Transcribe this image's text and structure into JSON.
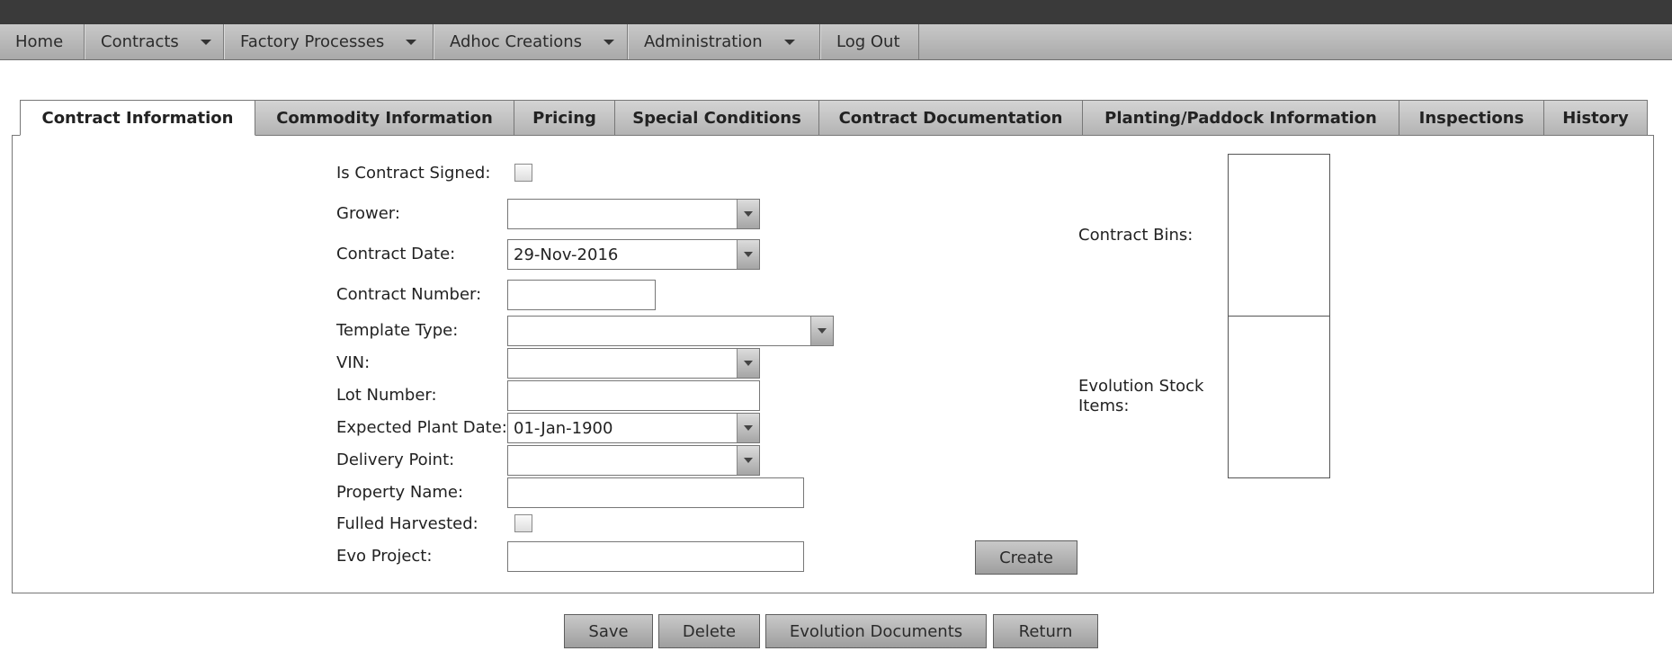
{
  "menu": {
    "items": [
      {
        "label": "Home",
        "has_dropdown": false
      },
      {
        "label": "Contracts",
        "has_dropdown": true
      },
      {
        "label": "Factory Processes",
        "has_dropdown": true
      },
      {
        "label": "Adhoc Creations",
        "has_dropdown": true
      },
      {
        "label": "Administration",
        "has_dropdown": true
      },
      {
        "label": "Log Out",
        "has_dropdown": false
      }
    ]
  },
  "tabs": [
    {
      "label": "Contract Information",
      "active": true
    },
    {
      "label": "Commodity Information",
      "active": false
    },
    {
      "label": "Pricing",
      "active": false
    },
    {
      "label": "Special Conditions",
      "active": false
    },
    {
      "label": "Contract Documentation",
      "active": false
    },
    {
      "label": "Planting/Paddock Information",
      "active": false
    },
    {
      "label": "Inspections",
      "active": false
    },
    {
      "label": "History",
      "active": false
    }
  ],
  "form": {
    "is_contract_signed": {
      "label": "Is Contract Signed:",
      "checked": false
    },
    "grower": {
      "label": "Grower:",
      "value": ""
    },
    "contract_date": {
      "label": "Contract Date:",
      "value": "29-Nov-2016"
    },
    "contract_number": {
      "label": "Contract Number:",
      "value": ""
    },
    "template_type": {
      "label": "Template Type:",
      "value": ""
    },
    "vin": {
      "label": "VIN:",
      "value": ""
    },
    "lot_number": {
      "label": "Lot Number:",
      "value": ""
    },
    "expected_plant_date": {
      "label": "Expected Plant Date:",
      "value": "01-Jan-1900"
    },
    "delivery_point": {
      "label": "Delivery Point:",
      "value": ""
    },
    "property_name": {
      "label": "Property Name:",
      "value": ""
    },
    "fulled_harvested": {
      "label": "Fulled Harvested:",
      "checked": false
    },
    "evo_project": {
      "label": "Evo Project:",
      "value": ""
    },
    "create_label": "Create",
    "contract_bins_label": "Contract Bins:",
    "evolution_stock_items_label": "Evolution Stock Items:"
  },
  "actions": {
    "save": "Save",
    "delete": "Delete",
    "evolution_documents": "Evolution Documents",
    "return": "Return"
  },
  "colors": {
    "top_bar": "#3a3a3a",
    "menu_bar": "#b5b5b5",
    "tab_inactive": "#c3c3c3",
    "tab_active": "#ffffff"
  }
}
